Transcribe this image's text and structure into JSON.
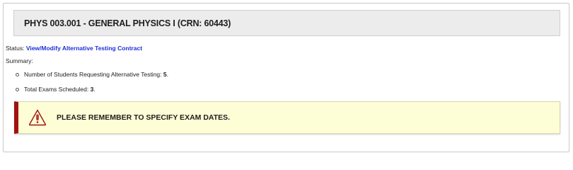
{
  "course": {
    "title": "PHYS 003.001 - GENERAL PHYSICS I (CRN: 60443)"
  },
  "status": {
    "label": "Status: ",
    "link_text": "View/Modify Alternative Testing Contract"
  },
  "summary": {
    "label": "Summary:",
    "items": [
      {
        "text": "Number of Students Requesting Alternative Testing: ",
        "value": "5",
        "suffix": "."
      },
      {
        "text": "Total Exams Scheduled: ",
        "value": "3",
        "suffix": "."
      }
    ]
  },
  "alert": {
    "icon": "warning-triangle-icon",
    "message": "PLEASE REMEMBER TO SPECIFY EXAM DATES.",
    "colors": {
      "accent": "#a31010",
      "background": "#fdfdd6"
    }
  },
  "colors": {
    "link": "#1f2fd6",
    "header_background": "#ececec"
  }
}
